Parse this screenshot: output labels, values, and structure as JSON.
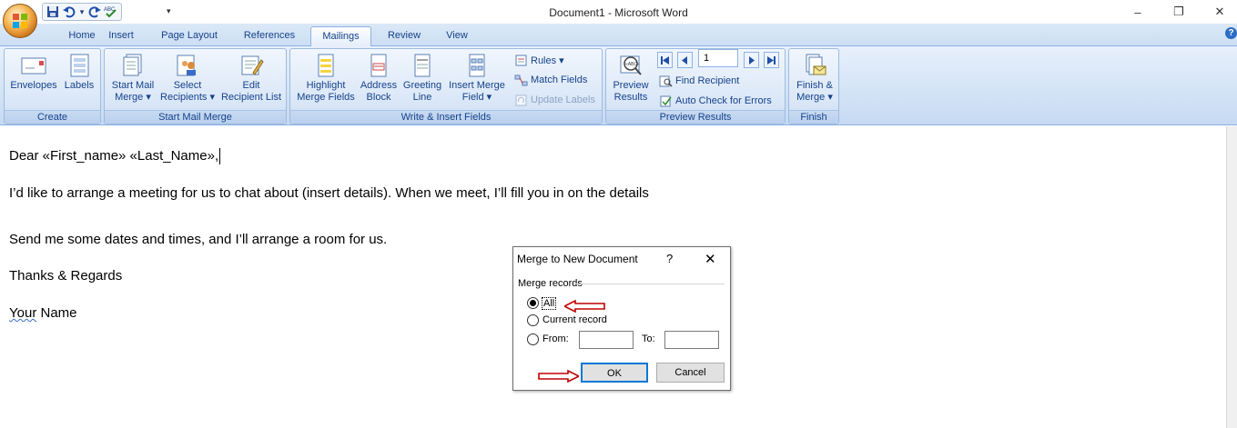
{
  "app": {
    "window_title": "Document1 - Microsoft Word",
    "window_controls": {
      "minimize": "–",
      "restore": "❐",
      "close": "✕"
    },
    "help_icon": "?"
  },
  "quick_access": {
    "items": [
      "save-icon",
      "undo-icon",
      "undo-dropdown-icon",
      "redo-icon",
      "spelling-icon",
      "customize-icon"
    ],
    "glyphs": {
      "undo_dropdown": "▾",
      "customize": "▾"
    }
  },
  "tabs": [
    {
      "label": "Home"
    },
    {
      "label": "Insert"
    },
    {
      "label": "Page Layout"
    },
    {
      "label": "References"
    },
    {
      "label": "Mailings",
      "active": true
    },
    {
      "label": "Review"
    },
    {
      "label": "View"
    }
  ],
  "ribbon": {
    "groups": {
      "create": "Create",
      "start_mail_merge": "Start Mail Merge",
      "write_insert": "Write & Insert Fields",
      "preview_results": "Preview Results",
      "finish": "Finish"
    },
    "buttons": {
      "envelopes": "Envelopes",
      "labels": "Labels",
      "start_mail_merge_1": "Start Mail",
      "start_mail_merge_2": "Merge ▾",
      "select_recipients_1": "Select",
      "select_recipients_2": "Recipients ▾",
      "edit_recipient_1": "Edit",
      "edit_recipient_2": "Recipient List",
      "highlight_1": "Highlight",
      "highlight_2": "Merge Fields",
      "address_1": "Address",
      "address_2": "Block",
      "greeting_1": "Greeting",
      "greeting_2": "Line",
      "insert_field_1": "Insert Merge",
      "insert_field_2": "Field ▾",
      "rules": "Rules ▾",
      "match_fields": "Match Fields",
      "update_labels": "Update Labels",
      "preview_1": "Preview",
      "preview_2": "Results",
      "record_number": "1",
      "find_recipient": "Find Recipient",
      "auto_check": "Auto Check for Errors",
      "finish_1": "Finish &",
      "finish_2": "Merge ▾"
    }
  },
  "document": {
    "line1": "Dear «First_name» «Last_Name»,",
    "line2": "I’d like to arrange a meeting for us to chat about (insert details). When we meet, I’ll fill you in on the details",
    "line3": "Send me some dates and times, and I’ll arrange a room for us.",
    "line4": "Thanks & Regards",
    "line5_a": "Your",
    "line5_b": " Name"
  },
  "dialog": {
    "title": "Merge to New Document",
    "help": "?",
    "close": "✕",
    "section": "Merge records",
    "options": {
      "all": "All",
      "current": "Current record",
      "from": "From:",
      "to": "To:"
    },
    "selected": "all",
    "from_value": "",
    "to_value": "",
    "ok": "OK",
    "cancel": "Cancel"
  },
  "colors": {
    "ribbon_text": "#15428b",
    "annotation_arrow": "#c00000",
    "default_button_border": "#0078d7"
  }
}
